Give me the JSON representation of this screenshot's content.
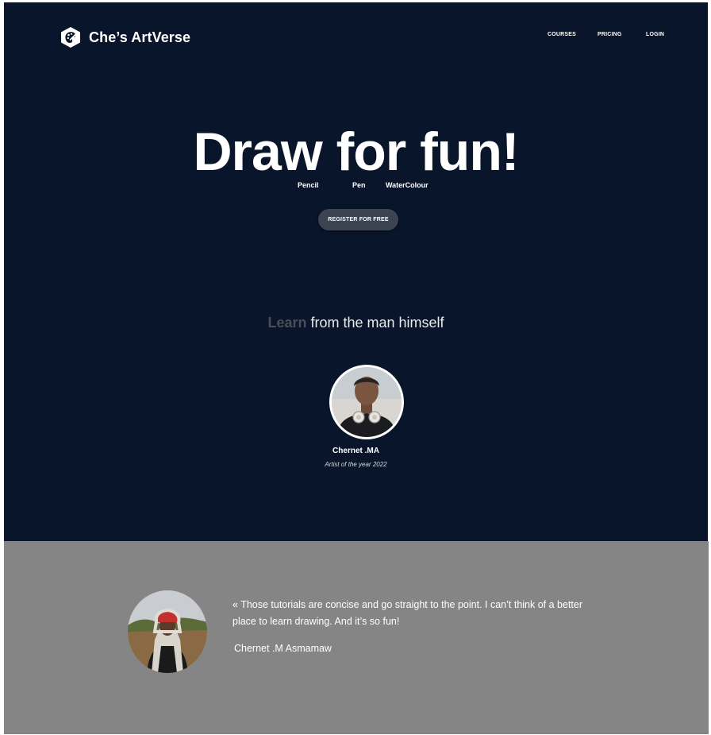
{
  "brand": {
    "name": "Che’s ArtVerse",
    "logo_icon": "palette-icon"
  },
  "nav": {
    "items": [
      {
        "label": "COURSES"
      },
      {
        "label": "PRICING"
      },
      {
        "label": "LOGIN"
      }
    ]
  },
  "hero": {
    "headline": "Draw for fun!",
    "mediums": [
      "Pencil",
      "Pen",
      "WaterColour"
    ],
    "cta_label": "REGISTER FOR FREE"
  },
  "learn": {
    "accent": "Learn",
    "rest": " from the man himself"
  },
  "instructor": {
    "name": "Chernet .MA",
    "title": "Artist of the year 2022"
  },
  "testimonial": {
    "quote": "« Those tutorials are concise and go straight to the point. I can’t think of a better place to learn drawing. And it’s so fun!",
    "author": "Chernet .M Asmamaw"
  },
  "colors": {
    "hero_bg": "#08152a",
    "testimonial_bg": "#858585",
    "cta_bg": "#3b4450",
    "learn_accent": "#4a4f57"
  }
}
